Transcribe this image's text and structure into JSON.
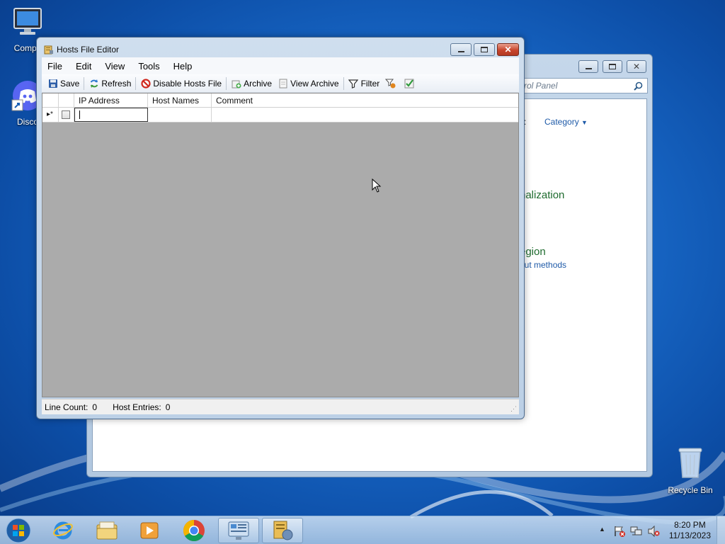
{
  "desktop": {
    "icons": [
      {
        "label": "Compu",
        "icon": "computer-icon"
      },
      {
        "label": "Disco",
        "icon": "discord-icon"
      },
      {
        "label": "Recycle Bin",
        "icon": "recycle-bin-icon"
      }
    ]
  },
  "control_panel": {
    "search_placeholder": "rol Panel",
    "view_by_label": "y:",
    "view_by_value": "Category",
    "heading_personalization": "nalization",
    "heading_region": "egion",
    "link_input_methods": "out methods"
  },
  "hosts_window": {
    "title": "Hosts File Editor",
    "menu": [
      "File",
      "Edit",
      "View",
      "Tools",
      "Help"
    ],
    "toolbar": {
      "save": "Save",
      "refresh": "Refresh",
      "disable": "Disable Hosts File",
      "archive": "Archive",
      "view_archive": "View Archive",
      "filter": "Filter"
    },
    "columns": {
      "ip": "IP Address",
      "hosts": "Host Names",
      "comment": "Comment"
    },
    "new_row_marker": "▸*",
    "status": {
      "line_count_label": "Line Count:",
      "line_count": "0",
      "host_entries_label": "Host Entries:",
      "host_entries": "0"
    }
  },
  "taskbar": {
    "time": "8:20 PM",
    "date": "11/13/2023"
  },
  "colors": {
    "accent": "#1a6ccc",
    "grid_empty": "#ababab",
    "cp_green": "#1e6b2e"
  }
}
